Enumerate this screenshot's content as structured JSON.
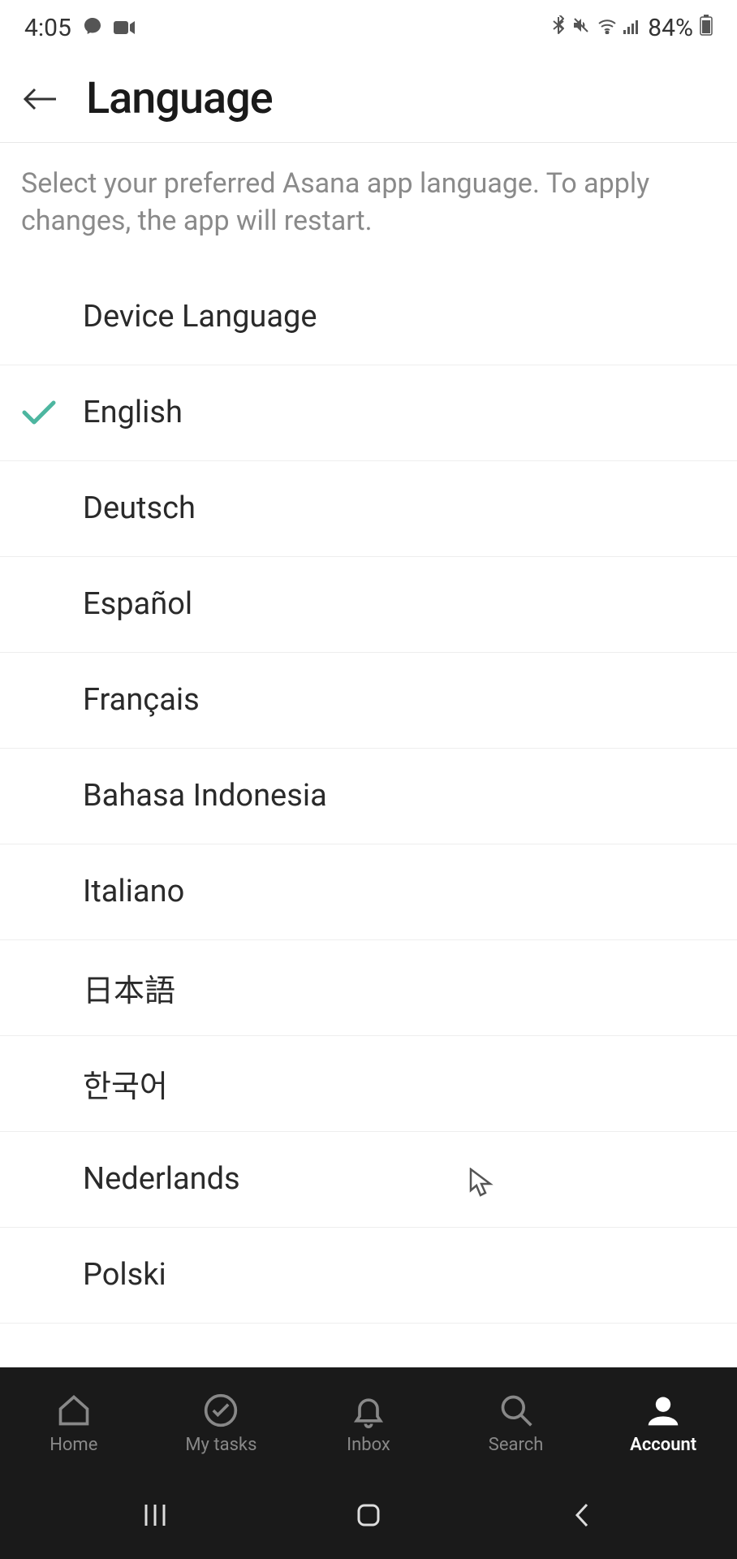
{
  "status": {
    "time": "4:05",
    "battery_pct": "84%"
  },
  "header": {
    "title": "Language"
  },
  "description": "Select your preferred Asana app language. To apply changes, the app will restart.",
  "languages": [
    {
      "label": "Device Language",
      "selected": false
    },
    {
      "label": "English",
      "selected": true
    },
    {
      "label": "Deutsch",
      "selected": false
    },
    {
      "label": "Español",
      "selected": false
    },
    {
      "label": "Français",
      "selected": false
    },
    {
      "label": "Bahasa Indonesia",
      "selected": false
    },
    {
      "label": "Italiano",
      "selected": false
    },
    {
      "label": "日本語",
      "selected": false
    },
    {
      "label": "한국어",
      "selected": false
    },
    {
      "label": "Nederlands",
      "selected": false
    },
    {
      "label": "Polski",
      "selected": false
    }
  ],
  "bottom_nav": [
    {
      "label": "Home",
      "icon": "home-icon",
      "active": false
    },
    {
      "label": "My tasks",
      "icon": "check-circle-icon",
      "active": false
    },
    {
      "label": "Inbox",
      "icon": "bell-icon",
      "active": false
    },
    {
      "label": "Search",
      "icon": "search-icon",
      "active": false
    },
    {
      "label": "Account",
      "icon": "person-icon",
      "active": true
    }
  ]
}
